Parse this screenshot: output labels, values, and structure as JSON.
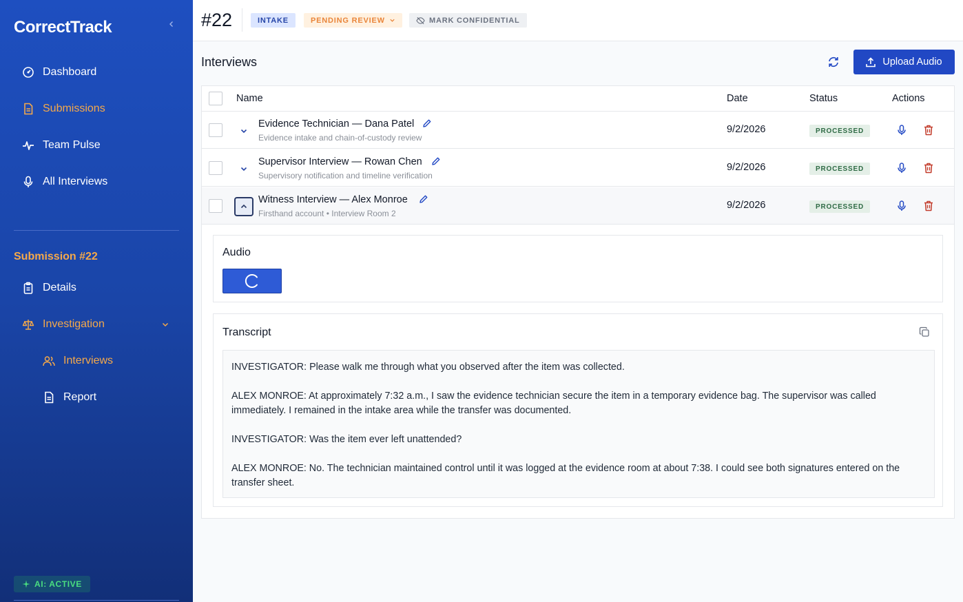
{
  "app": {
    "name": "CorrectTrack"
  },
  "sidebar": {
    "nav": [
      {
        "label": "Dashboard",
        "icon": "dashboard-icon",
        "active": false
      },
      {
        "label": "Submissions",
        "icon": "document-icon",
        "active": true
      },
      {
        "label": "Team Pulse",
        "icon": "pulse-icon",
        "active": false
      },
      {
        "label": "All Interviews",
        "icon": "microphone-icon",
        "active": false
      }
    ],
    "section_title": "Submission #22",
    "section_nav": [
      {
        "label": "Details",
        "icon": "clipboard-icon"
      },
      {
        "label": "Investigation",
        "icon": "scales-icon"
      }
    ],
    "sub_nav": [
      {
        "label": "Interviews",
        "icon": "users-icon",
        "active": true
      },
      {
        "label": "Report",
        "icon": "report-icon",
        "active": false
      }
    ],
    "ai_status": "AI: ACTIVE"
  },
  "header": {
    "case_number": "#22",
    "stage_badge": "INTAKE",
    "status_dropdown": "PENDING REVIEW",
    "confidential_button": "MARK CONFIDENTIAL"
  },
  "main": {
    "title": "Interviews",
    "upload_label": "Upload Audio",
    "columns": {
      "name": "Name",
      "date": "Date",
      "status": "Status",
      "actions": "Actions"
    },
    "rows": [
      {
        "title": "Evidence Technician — Dana Patel",
        "subtitle": "Evidence intake and chain-of-custody review",
        "date": "9/2/2026",
        "status": "PROCESSED",
        "expanded": false
      },
      {
        "title": "Supervisor Interview — Rowan Chen",
        "subtitle": "Supervisory notification and timeline verification",
        "date": "9/2/2026",
        "status": "PROCESSED",
        "expanded": false
      },
      {
        "title": "Witness Interview — Alex Monroe",
        "subtitle": "Firsthand account • Interview Room 2",
        "date": "9/2/2026",
        "status": "PROCESSED",
        "expanded": true
      }
    ],
    "audio_title": "Audio",
    "transcript_title": "Transcript",
    "transcript": [
      "INVESTIGATOR: Please walk me through what you observed after the item was collected.",
      "ALEX MONROE: At approximately 7:32 a.m., I saw the evidence technician secure the item in a temporary evidence bag. The supervisor was called immediately. I remained in the intake area while the transfer was documented.",
      "INVESTIGATOR: Was the item ever left unattended?",
      "ALEX MONROE: No. The technician maintained control until it was logged at the evidence room at about 7:38. I could see both signatures entered on the transfer sheet."
    ]
  },
  "colors": {
    "accent": "#2148c4",
    "active_nav": "#f5a94a",
    "processed_bg": "#e4efe7",
    "processed_text": "#2f6b45",
    "delete": "#c23b2a"
  }
}
